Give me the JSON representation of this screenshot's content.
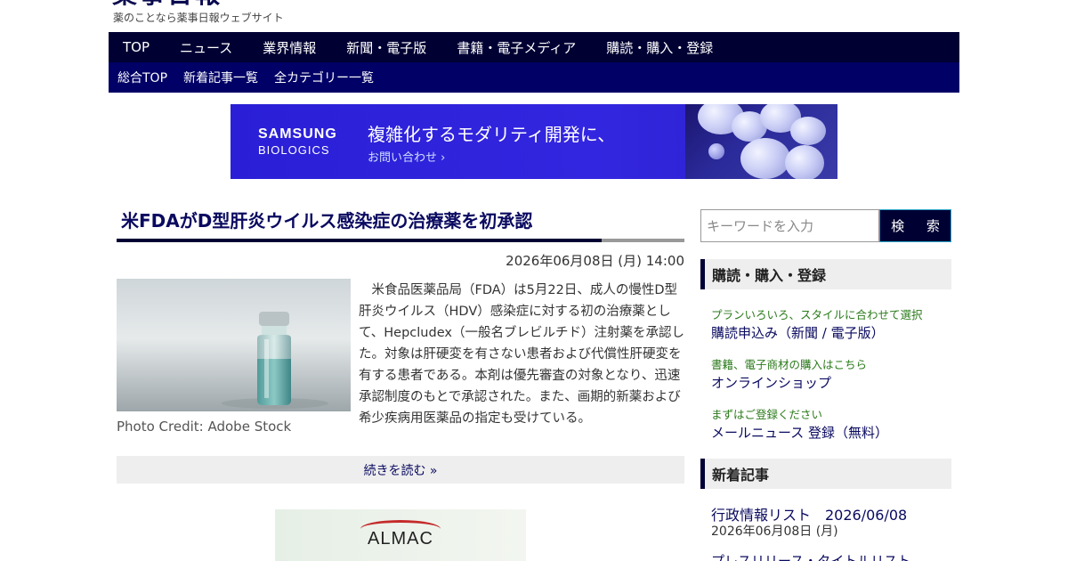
{
  "site": {
    "logo_text": "薬事日報",
    "tagline": "薬のことなら薬事日報ウェブサイト"
  },
  "nav_main": [
    "TOP",
    "ニュース",
    "業界情報",
    "新聞・電子版",
    "書籍・電子メディア",
    "購読・購入・登録"
  ],
  "nav_sub": [
    "総合TOP",
    "新着記事一覧",
    "全カテゴリー一覧"
  ],
  "banner": {
    "brand_line1": "SAMSUNG",
    "brand_line2": "BIOLOGICS",
    "headline": "複雑化するモダリティ開発に、",
    "cta": "お問い合わせ ›"
  },
  "article": {
    "title": "米FDAがD型肝炎ウイルス感染症の治療薬を初承認",
    "date": "2026年06月08日 (月) 14:00",
    "photo_credit": "Photo Credit: Adobe Stock",
    "body": "　米食品医薬品局（FDA）は5月22日、成人の慢性D型肝炎ウイルス（HDV）感染症に対する初の治療薬として、Hepcludex（一般名ブレビルチド）注射薬を承認した。対象は肝硬変を有さない患者および代償性肝硬変を有する患者である。本剤は優先審査の対象となり、迅速承認制度のもとで承認された。また、画期的新薬および希少疾病用医薬品の指定も受けている。",
    "read_more": "続きを読む »"
  },
  "ad2": {
    "text": "ALMAC"
  },
  "sidebar": {
    "search_placeholder": "キーワードを入力",
    "search_button": "検 索",
    "section1_title": "購読・購入・登録",
    "items": [
      {
        "note": "プランいろいろ、スタイルに合わせて選択",
        "link": "購読申込み（新聞 / 電子版）"
      },
      {
        "note": "書籍、電子商材の購入はこちら",
        "link": "オンラインショップ"
      },
      {
        "note": "まずはご登録ください",
        "link": "メールニュース 登録（無料）"
      }
    ],
    "section2_title": "新着記事",
    "news": [
      {
        "link": "行政情報リスト　2026/06/08",
        "date": "2026年06月08日 (月)"
      },
      {
        "link": "プレスリリース・タイトルリスト",
        "date": ""
      }
    ]
  },
  "colors": {
    "nav_dark": "#000033",
    "nav_sub": "#000066",
    "banner_blue": "#2a1fd6",
    "link": "#0a0a60",
    "note_green": "#2a7a1a"
  }
}
